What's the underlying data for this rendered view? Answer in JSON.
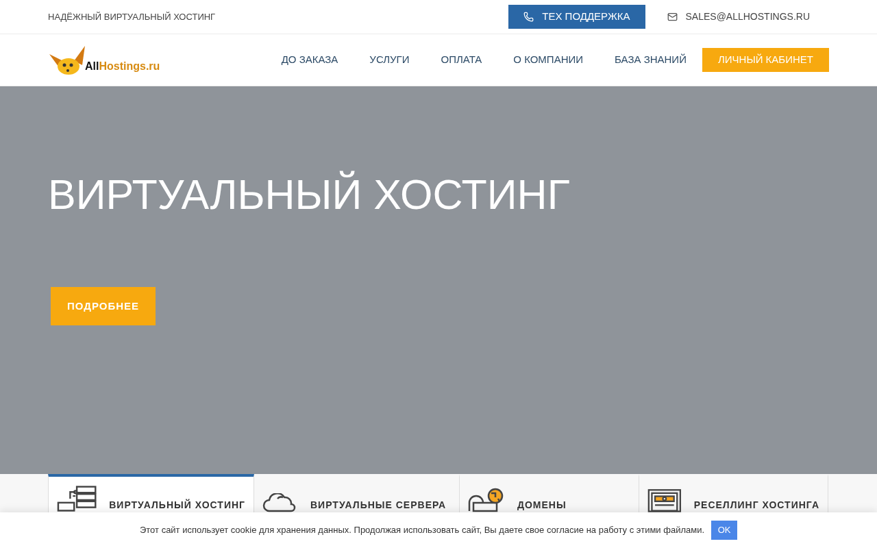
{
  "topbar": {
    "tagline": "НАДЁЖНЫЙ ВИРТУАЛЬНЫЙ ХОСТИНГ",
    "support_button": "ТЕХ ПОДДЕРЖКА",
    "email": "SALES@ALLHOSTINGS.RU"
  },
  "logo": {
    "part_1": "All",
    "part_2": "Hostings.ru"
  },
  "nav": {
    "items": [
      {
        "label": "ДО ЗАКАЗА"
      },
      {
        "label": "УСЛУГИ"
      },
      {
        "label": "ОПЛАТА"
      },
      {
        "label": "О КОМПАНИИ"
      },
      {
        "label": "БАЗА ЗНАНИЙ"
      }
    ],
    "account_button": "ЛИЧНЫЙ КАБИНЕТ"
  },
  "hero": {
    "title": "ВИРТУАЛЬНЫЙ ХОСТИНГ",
    "button": "ПОДРОБНЕЕ"
  },
  "service_tabs": [
    {
      "kind": "servers",
      "label": "ВИРТУАЛЬНЫЙ ХОСТИНГ",
      "selected": true
    },
    {
      "kind": "cloud",
      "label": "ВИРТУАЛЬНЫЕ СЕРВЕРА",
      "selected": false
    },
    {
      "kind": "globe",
      "label": "ДОМЕНЫ",
      "selected": false
    },
    {
      "kind": "panel",
      "label": "РЕСЕЛЛИНГ ХОСТИНГА",
      "selected": false
    }
  ],
  "cookie_bar": {
    "text": "Этот сайт использует cookie для хранения данных. Продолжая использовать сайт, Вы даете свое согласие на работу с этими файлами.",
    "button": "OK"
  }
}
